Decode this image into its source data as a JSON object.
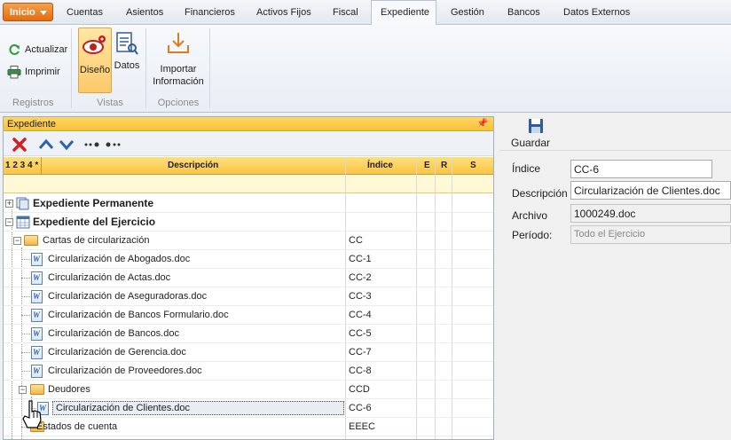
{
  "menubar": {
    "start_label": "Inicio",
    "tabs": [
      {
        "label": "Cuentas"
      },
      {
        "label": "Asientos"
      },
      {
        "label": "Financieros"
      },
      {
        "label": "Activos Fijos"
      },
      {
        "label": "Fiscal"
      },
      {
        "label": "Expediente",
        "active": true
      },
      {
        "label": "Gestión"
      },
      {
        "label": "Bancos"
      },
      {
        "label": "Datos Externos"
      }
    ]
  },
  "ribbon": {
    "registros": {
      "label": "Registros",
      "actualizar": "Actualizar",
      "imprimir": "Imprimir"
    },
    "vistas": {
      "label": "Vistas",
      "diseno": "Diseño",
      "datos": "Datos"
    },
    "opciones": {
      "label": "Opciones",
      "importar_line1": "Importar",
      "importar_line2": "Información"
    }
  },
  "panel": {
    "title": "Expediente",
    "columns": {
      "levels": "1 2 3 4 *",
      "descripcion": "Descripción",
      "indice": "Índice",
      "e": "E",
      "r": "R",
      "s": "S"
    },
    "rows": [
      {
        "desc": "Expediente Permanente",
        "index": ""
      },
      {
        "desc": "Expediente del Ejercicio",
        "index": ""
      },
      {
        "desc": "Cartas de circularización",
        "index": "CC"
      },
      {
        "desc": "Circularización de Abogados.doc",
        "index": "CC-1"
      },
      {
        "desc": "Circularización de Actas.doc",
        "index": "CC-2"
      },
      {
        "desc": "Circularización de Aseguradoras.doc",
        "index": "CC-3"
      },
      {
        "desc": "Circularización de Bancos Formulario.doc",
        "index": "CC-4"
      },
      {
        "desc": "Circularización de Bancos.doc",
        "index": "CC-5"
      },
      {
        "desc": "Circularización de Gerencia.doc",
        "index": "CC-7"
      },
      {
        "desc": "Circularización de Proveedores.doc",
        "index": "CC-8"
      },
      {
        "desc": "Deudores",
        "index": "CCD"
      },
      {
        "desc": "Circularización de Clientes.doc",
        "index": "CC-6"
      },
      {
        "desc": "Estados de cuenta",
        "index": "EEEC"
      }
    ]
  },
  "details": {
    "save_label": "Guardar",
    "indice": {
      "label": "Índice",
      "value": "CC-6"
    },
    "descripcion": {
      "label": "Descripción",
      "value": "Circularización de Clientes.doc"
    },
    "archivo": {
      "label": "Archivo",
      "value": "1000249.doc"
    },
    "periodo": {
      "label": "Período:",
      "value": "Todo el Ejercicio"
    }
  },
  "colors": {
    "accent_orange": "#e46c12",
    "header_yellow": "#f9c544",
    "filter_yellow": "#fff9d6",
    "selection": "#fbc96a"
  }
}
